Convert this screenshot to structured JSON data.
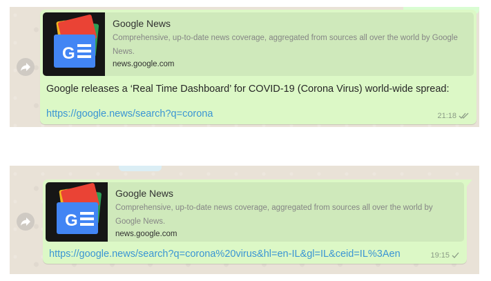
{
  "messages": [
    {
      "preview": {
        "title": "Google News",
        "description": "Comprehensive, up-to-date news coverage, aggregated from sources all over the world by Google News.",
        "domain": "news.google.com",
        "icon": "google-news-logo"
      },
      "text": "Google releases a ‘Real Time Dashboard’ for COVID-19 (Corona Virus) world-wide spread:",
      "link": "https://google.news/search?q=corona",
      "time": "21:18",
      "status": "double-check"
    },
    {
      "preview": {
        "title": "Google News",
        "description": "Comprehensive, up-to-date news coverage, aggregated from sources all over the world by Google News.",
        "domain": "news.google.com",
        "icon": "google-news-logo"
      },
      "link": "https://google.news/search?q=corona%20virus&hl=en-IL&gl=IL&ceid=IL%3Aen",
      "time": "19:15",
      "status": "single-check"
    }
  ],
  "colors": {
    "bubble": "#dcf8c6",
    "preview_bg": "#cfe9bb",
    "link": "#3a95d4",
    "chat_bg": "#e9e2d7"
  }
}
